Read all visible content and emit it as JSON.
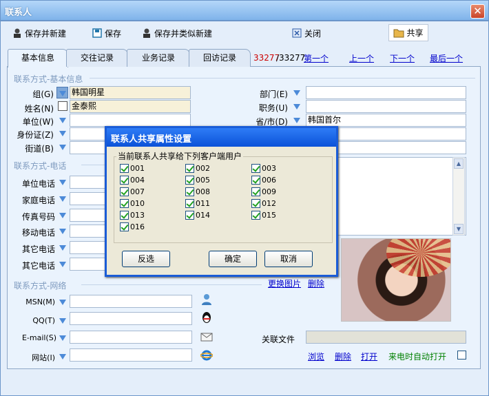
{
  "window": {
    "title": "联系人",
    "close_glyph": "✕"
  },
  "toolbar": {
    "save_new": "保存并新建",
    "save": "保存",
    "save_similar": "保存并类似新建",
    "close": "关闭",
    "share": "共享"
  },
  "tabs": [
    "基本信息",
    "交往记录",
    "业务记录",
    "回访记录"
  ],
  "record_nav": {
    "current": "33277",
    "total": "/33277",
    "first": "第一个",
    "prev": "上一个",
    "next": "下一个",
    "last": "最后一个"
  },
  "basic": {
    "section": "联系方式-基本信息",
    "group_label": "组(G)",
    "group_value": "韩国明星",
    "name_label": "姓名(N)",
    "name_value": "金泰熙",
    "unit_label": "单位(W)",
    "id_label": "身份证(Z)",
    "street_label": "街道(B)",
    "dept_label": "部门(E)",
    "title_label": "职务(U)",
    "province_label": "省/市(D)",
    "province_value": "韩国首尔"
  },
  "phone": {
    "section": "联系方式-电话",
    "labels": [
      "单位电话",
      "家庭电话",
      "传真号码",
      "移动电话",
      "其它电话",
      "其它电话"
    ]
  },
  "network": {
    "section": "联系方式-网络",
    "msn": "MSN(M)",
    "qq": "QQ(T)",
    "email": "E-mail(S)",
    "website": "网站(I)"
  },
  "photo": {
    "change": "更换图片",
    "delete": "删除"
  },
  "files": {
    "label": "关联文件",
    "browse": "浏览",
    "delete": "删除",
    "open": "打开",
    "auto_open": "来电时自动打开"
  },
  "dialog": {
    "title": "联系人共享属性设置",
    "group_label": "当前联系人共享给下列客户端用户",
    "users": [
      "001",
      "002",
      "003",
      "004",
      "005",
      "006",
      "007",
      "008",
      "009",
      "010",
      "011",
      "012",
      "013",
      "014",
      "015",
      "016"
    ],
    "invert": "反选",
    "ok": "确定",
    "cancel": "取消"
  }
}
